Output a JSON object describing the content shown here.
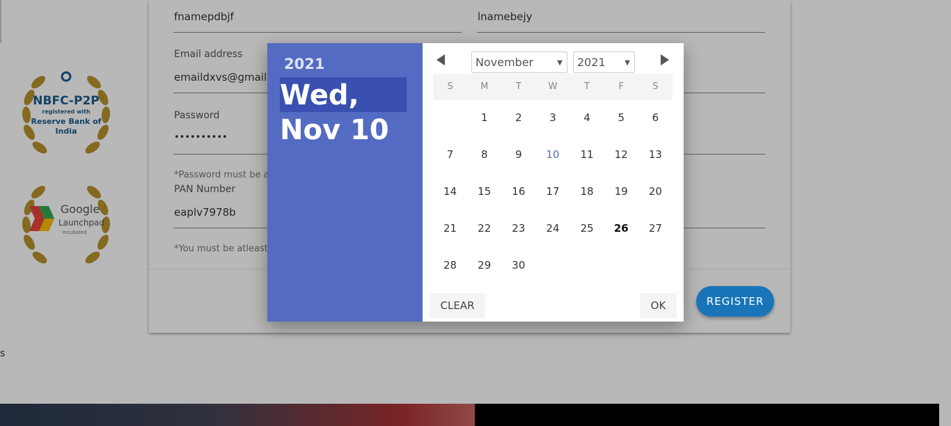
{
  "form": {
    "first_name_value": "fnamepdbjf",
    "last_name_value": "lnamebejy",
    "email_label": "Email address",
    "email_value": "emaildxvs@gmail",
    "password_label": "Password",
    "password_value": "••••••••••",
    "password_hint": "*Password must be a",
    "pan_label": "PAN Number",
    "pan_value": "eaplv7978b",
    "age_hint": "*You must be atleast",
    "register_label": "REGISTER"
  },
  "badges": {
    "nbfc_line1": "NBFC-P2P",
    "nbfc_line2": "registered with",
    "nbfc_line3": "Reserve Bank of",
    "nbfc_line4": "India",
    "google_line1": "Google",
    "google_line2": "Launchpad",
    "google_line3": "Incubated"
  },
  "misc": {
    "stray_text": "s"
  },
  "datepicker": {
    "header_year": "2021",
    "header_date": "Wed, Nov 10",
    "month_selected": "November",
    "year_selected": "2021",
    "weekdays": [
      "S",
      "M",
      "T",
      "W",
      "T",
      "F",
      "S"
    ],
    "days": [
      "1",
      "2",
      "3",
      "4",
      "5",
      "6",
      "7",
      "8",
      "9",
      "10",
      "11",
      "12",
      "13",
      "14",
      "15",
      "16",
      "17",
      "18",
      "19",
      "20",
      "21",
      "22",
      "23",
      "24",
      "25",
      "26",
      "27",
      "28",
      "29",
      "30"
    ],
    "first_weekday_offset": 1,
    "today": "10",
    "bold_day": "26",
    "clear_label": "CLEAR",
    "ok_label": "OK"
  },
  "colors": {
    "header_bg": "#546bc3",
    "header_highlight": "#3a50b0",
    "register_bg": "#1a75b8",
    "today_color": "#546bc3"
  }
}
